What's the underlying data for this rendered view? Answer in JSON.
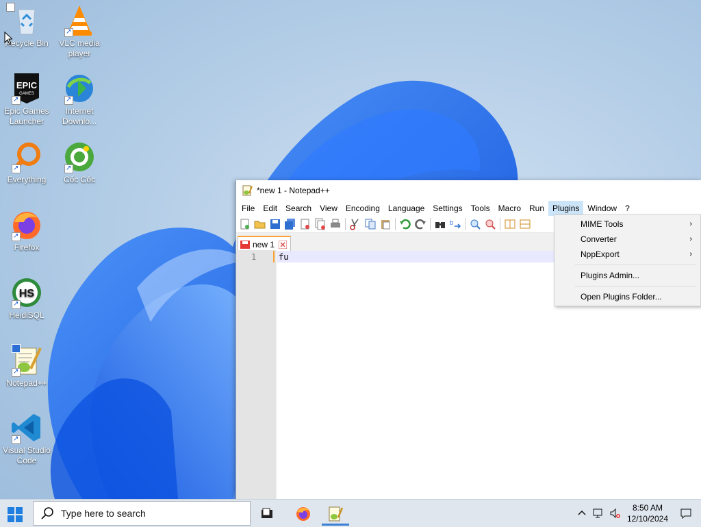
{
  "desktop_icons": [
    {
      "label": "Recycle Bin",
      "icon": "recycle-bin-icon"
    },
    {
      "label": "VLC media player",
      "icon": "vlc-icon"
    },
    {
      "label": "Epic Games Launcher",
      "icon": "epic-games-icon",
      "badge": "EPIC GAMES"
    },
    {
      "label": "Internet Downlo...",
      "icon": "internet-download-manager-icon"
    },
    {
      "label": "Everything",
      "icon": "everything-search-icon"
    },
    {
      "label": "Cốc Cốc",
      "icon": "coccoc-browser-icon"
    },
    {
      "label": "Firefox",
      "icon": "firefox-icon"
    },
    {
      "label": "HeidiSQL",
      "icon": "heidisql-icon",
      "badge": "HS"
    },
    {
      "label": "Notepad++",
      "icon": "notepadpp-icon"
    },
    {
      "label": "Visual Studio Code",
      "icon": "vscode-icon"
    }
  ],
  "window": {
    "title": "*new 1 - Notepad++",
    "menu": [
      "File",
      "Edit",
      "Search",
      "View",
      "Encoding",
      "Language",
      "Settings",
      "Tools",
      "Macro",
      "Run",
      "Plugins",
      "Window",
      "?"
    ],
    "active_menu": "Plugins",
    "tab": {
      "label": "new 1"
    },
    "editor": {
      "line_number": "1",
      "line_text": "fu"
    }
  },
  "plugins_menu": {
    "items": [
      {
        "label": "MIME Tools",
        "submenu": true
      },
      {
        "label": "Converter",
        "submenu": true
      },
      {
        "label": "NppExport",
        "submenu": true
      },
      {
        "label": "Plugins Admin...",
        "submenu": false
      },
      {
        "label": "Open Plugins Folder...",
        "submenu": false
      }
    ],
    "arrow": "›"
  },
  "taskbar": {
    "search_placeholder": "Type here to search",
    "clock_time": "8:50 AM",
    "clock_date": "12/10/2024"
  },
  "colors": {
    "accent": "#3b7fd6",
    "tab_highlight": "#f9a335",
    "menu_hover": "#cce4f7"
  }
}
